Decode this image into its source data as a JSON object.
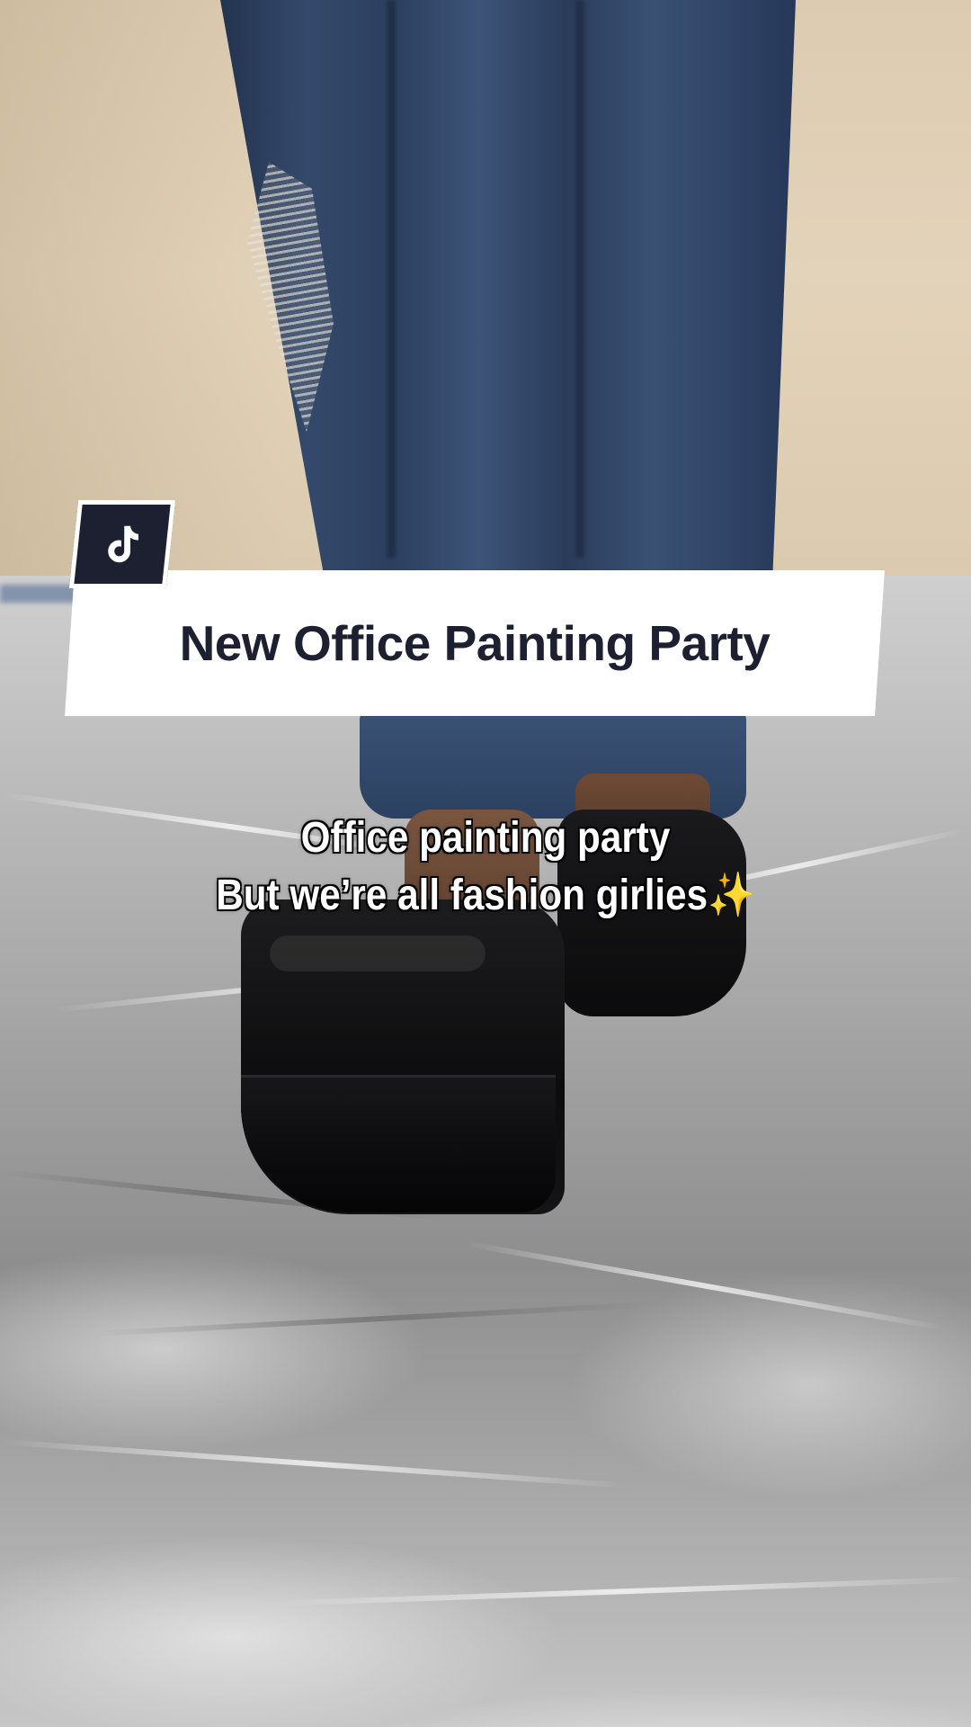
{
  "title_card": {
    "text": "New Office Painting Party"
  },
  "caption": {
    "line1": "Office painting party",
    "line2": "But we’re all fashion girlies",
    "line2_emoji": "✨"
  },
  "logo": {
    "icon": "tiktok-note-icon"
  },
  "colors": {
    "title_card_bg": "#ffffff",
    "title_text": "#1c2030",
    "logo_bg": "#1c2030",
    "caption_text": "#ffffff",
    "caption_stroke": "#000000"
  }
}
